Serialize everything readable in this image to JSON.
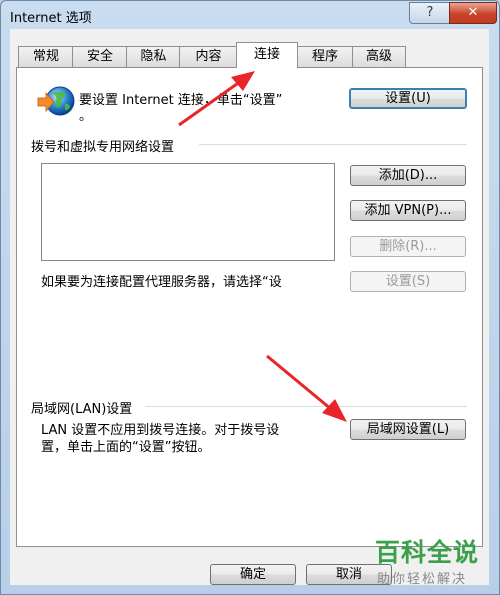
{
  "window": {
    "title": "Internet 选项",
    "help_label": "?",
    "close_label": "✕"
  },
  "tabs": [
    {
      "label": "常规"
    },
    {
      "label": "安全"
    },
    {
      "label": "隐私"
    },
    {
      "label": "内容"
    },
    {
      "label": "连接"
    },
    {
      "label": "程序"
    },
    {
      "label": "高级"
    }
  ],
  "setup": {
    "text_line1": "要设置 Internet 连接，单击“设置”",
    "text_line2": "。",
    "button": "设置(U)"
  },
  "dialup": {
    "title": "拨号和虚拟专用网络设置",
    "add_button": "添加(D)...",
    "add_vpn_button": "添加 VPN(P)...",
    "delete_button": "删除(R)...",
    "settings_button": "设置(S)",
    "proxy_note": "如果要为连接配置代理服务器，请选择“设"
  },
  "lan": {
    "title": "局域网(LAN)设置",
    "note_line1": "LAN 设置不应用到拨号连接。对于拨号设",
    "note_line2": "置，单击上面的“设置”按钮。",
    "button": "局域网设置(L)"
  },
  "footer": {
    "ok_button": "确定",
    "cancel_button": "取消"
  },
  "watermark": {
    "brand": "百科全说",
    "slogan": "助你轻松解决"
  },
  "colors": {
    "arrow": "#e8262a",
    "watermark": "#3aa04a"
  }
}
